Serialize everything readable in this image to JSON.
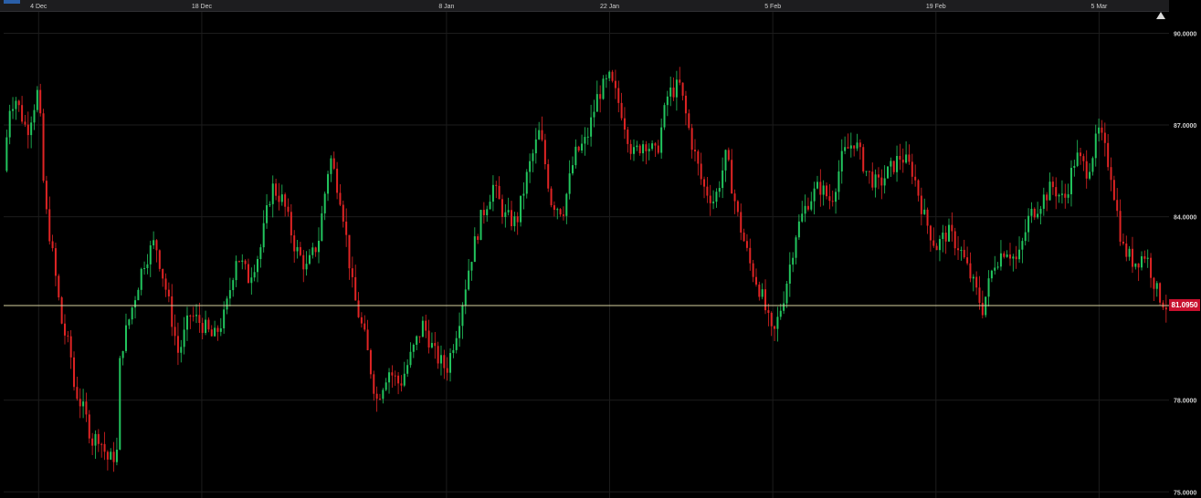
{
  "colors": {
    "background": "#000000",
    "grid": "#1c1c1c",
    "up": "#22c55e",
    "down": "#e02424",
    "current_line": "#d8d2a0",
    "badge": "#c8102e"
  },
  "icons": {
    "scroll_to_top": "triangle-up-icon"
  },
  "current_price": {
    "value": 81.095,
    "label": "81.0950"
  },
  "chart_data": {
    "type": "candlestick",
    "title": "",
    "xlabel": "",
    "ylabel": "",
    "grid": true,
    "y_axis_side": "right",
    "ylim": [
      74.8,
      90.7
    ],
    "yticks": [
      {
        "value": 90,
        "label": "90.0000"
      },
      {
        "value": 87,
        "label": "87.0000"
      },
      {
        "value": 84,
        "label": "84.0000"
      },
      {
        "value": 78,
        "label": "78.0000"
      },
      {
        "value": 75,
        "label": "75.0000"
      }
    ],
    "xlim": [
      "2017-12-01",
      "2018-03-11"
    ],
    "xticks": [
      {
        "date": "2017-12-04",
        "label": "4 Dec"
      },
      {
        "date": "2017-12-18",
        "label": "18 Dec"
      },
      {
        "date": "2018-01-08",
        "label": "8 Jan"
      },
      {
        "date": "2018-01-22",
        "label": "22 Jan"
      },
      {
        "date": "2018-02-05",
        "label": "5 Feb"
      },
      {
        "date": "2018-02-19",
        "label": "19 Feb"
      },
      {
        "date": "2018-03-05",
        "label": "5 Mar"
      }
    ],
    "price_path": [
      [
        "2017-12-01",
        85.5
      ],
      [
        "2017-12-01 12:00",
        87.6
      ],
      [
        "2017-12-02",
        87.9
      ],
      [
        "2017-12-03",
        86.8
      ],
      [
        "2017-12-04",
        88.2
      ],
      [
        "2017-12-04 12:00",
        84.5
      ],
      [
        "2017-12-05",
        83.3
      ],
      [
        "2017-12-06",
        80.5
      ],
      [
        "2017-12-06 18:00",
        79.5
      ],
      [
        "2017-12-07",
        78.5
      ],
      [
        "2017-12-08",
        77.5
      ],
      [
        "2017-12-08 18:00",
        76.5
      ],
      [
        "2017-12-09",
        77.0
      ],
      [
        "2017-12-10",
        76.0
      ],
      [
        "2017-12-10 18:00",
        76.3
      ],
      [
        "2017-12-11",
        79.5
      ],
      [
        "2017-12-12",
        81.0
      ],
      [
        "2017-12-13",
        82.5
      ],
      [
        "2017-12-14",
        83.2
      ],
      [
        "2017-12-15",
        81.5
      ],
      [
        "2017-12-16",
        79.5
      ],
      [
        "2017-12-17",
        80.8
      ],
      [
        "2017-12-18",
        80.5
      ],
      [
        "2017-12-19",
        80.0
      ],
      [
        "2017-12-20",
        80.8
      ],
      [
        "2017-12-21",
        82.8
      ],
      [
        "2017-12-22",
        82.0
      ],
      [
        "2017-12-23",
        82.9
      ],
      [
        "2017-12-24",
        85.0
      ],
      [
        "2017-12-25",
        84.5
      ],
      [
        "2017-12-26",
        83.0
      ],
      [
        "2017-12-27",
        82.3
      ],
      [
        "2017-12-28",
        83.2
      ],
      [
        "2017-12-29",
        86.0
      ],
      [
        "2017-12-30",
        84.5
      ],
      [
        "2017-12-31",
        81.5
      ],
      [
        "2018-01-01",
        80.0
      ],
      [
        "2018-01-02",
        78.0
      ],
      [
        "2018-01-03",
        79.0
      ],
      [
        "2018-01-04",
        78.5
      ],
      [
        "2018-01-05",
        79.5
      ],
      [
        "2018-01-06",
        80.5
      ],
      [
        "2018-01-07",
        79.5
      ],
      [
        "2018-01-08",
        79.0
      ],
      [
        "2018-01-09",
        80.5
      ],
      [
        "2018-01-10",
        82.5
      ],
      [
        "2018-01-11",
        84.0
      ],
      [
        "2018-01-12",
        85.0
      ],
      [
        "2018-01-13",
        84.0
      ],
      [
        "2018-01-14",
        83.8
      ],
      [
        "2018-01-15",
        85.5
      ],
      [
        "2018-01-16",
        86.8
      ],
      [
        "2018-01-17",
        84.5
      ],
      [
        "2018-01-18",
        84.2
      ],
      [
        "2018-01-19",
        86.0
      ],
      [
        "2018-01-20",
        86.5
      ],
      [
        "2018-01-21",
        88.0
      ],
      [
        "2018-01-22",
        88.5
      ],
      [
        "2018-01-23",
        87.5
      ],
      [
        "2018-01-24",
        86.0
      ],
      [
        "2018-01-25",
        86.5
      ],
      [
        "2018-01-26",
        86.0
      ],
      [
        "2018-01-27",
        88.0
      ],
      [
        "2018-01-28",
        88.3
      ],
      [
        "2018-01-29",
        86.5
      ],
      [
        "2018-01-30",
        85.0
      ],
      [
        "2018-01-31",
        84.5
      ],
      [
        "2018-02-01",
        86.0
      ],
      [
        "2018-02-02",
        84.0
      ],
      [
        "2018-02-03",
        82.5
      ],
      [
        "2018-02-04",
        81.5
      ],
      [
        "2018-02-05",
        80.0
      ],
      [
        "2018-02-06",
        81.5
      ],
      [
        "2018-02-07",
        83.5
      ],
      [
        "2018-02-08",
        84.5
      ],
      [
        "2018-02-09",
        85.0
      ],
      [
        "2018-02-10",
        84.5
      ],
      [
        "2018-02-11",
        86.0
      ],
      [
        "2018-02-12",
        86.5
      ],
      [
        "2018-02-13",
        85.5
      ],
      [
        "2018-02-14",
        85.0
      ],
      [
        "2018-02-15",
        85.5
      ],
      [
        "2018-02-16",
        86.0
      ],
      [
        "2018-02-17",
        85.5
      ],
      [
        "2018-02-18",
        84.0
      ],
      [
        "2018-02-19",
        83.0
      ],
      [
        "2018-02-20",
        83.5
      ],
      [
        "2018-02-21",
        83.0
      ],
      [
        "2018-02-22",
        82.0
      ],
      [
        "2018-02-23",
        81.0
      ],
      [
        "2018-02-24",
        82.5
      ],
      [
        "2018-02-25",
        83.0
      ],
      [
        "2018-02-26",
        82.5
      ],
      [
        "2018-02-27",
        84.0
      ],
      [
        "2018-02-28",
        84.5
      ],
      [
        "2018-03-01",
        85.0
      ],
      [
        "2018-03-02",
        84.5
      ],
      [
        "2018-03-03",
        86.0
      ],
      [
        "2018-03-04",
        85.5
      ],
      [
        "2018-03-05",
        86.8
      ],
      [
        "2018-03-06",
        85.5
      ],
      [
        "2018-03-07",
        83.0
      ],
      [
        "2018-03-08",
        82.5
      ],
      [
        "2018-03-09",
        82.8
      ],
      [
        "2018-03-10",
        81.5
      ],
      [
        "2018-03-10 18:00",
        81.1
      ]
    ]
  }
}
